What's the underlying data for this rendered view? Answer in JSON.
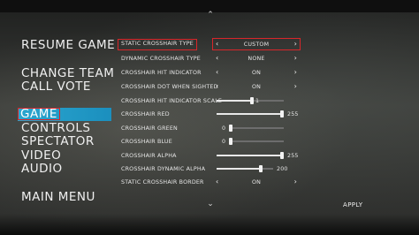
{
  "menu": {
    "items": [
      {
        "label": "RESUME GAME"
      },
      {
        "label": "CHANGE TEAM"
      },
      {
        "label": "CALL VOTE"
      },
      {
        "label": "GAME"
      },
      {
        "label": "CONTROLS"
      },
      {
        "label": "SPECTATOR"
      },
      {
        "label": "VIDEO"
      },
      {
        "label": "AUDIO"
      },
      {
        "label": "MAIN MENU"
      }
    ],
    "active_index": 3
  },
  "settings": {
    "rows": [
      {
        "name": "STATIC CROSSHAIR TYPE",
        "kind": "selector",
        "value": "CUSTOM"
      },
      {
        "name": "DYNAMIC CROSSHAIR TYPE",
        "kind": "selector",
        "value": "NONE"
      },
      {
        "name": "CROSSHAIR HIT INDICATOR",
        "kind": "selector",
        "value": "ON"
      },
      {
        "name": "CROSSHAIR DOT WHEN SIGHTED",
        "kind": "selector",
        "value": "ON"
      },
      {
        "name": "CROSSHAIR HIT INDICATOR SCALE",
        "kind": "slider",
        "value": "1",
        "fraction": 0.52
      },
      {
        "name": "CROSSHAIR RED",
        "kind": "slider",
        "value": "255",
        "fraction": 1.0
      },
      {
        "name": "CROSSHAIR GREEN",
        "kind": "slider",
        "value": "0",
        "fraction": 0.0
      },
      {
        "name": "CROSSHAIR BLUE",
        "kind": "slider",
        "value": "0",
        "fraction": 0.0
      },
      {
        "name": "CROSSHAIR ALPHA",
        "kind": "slider",
        "value": "255",
        "fraction": 1.0
      },
      {
        "name": "CROSSHAIR DYNAMIC ALPHA",
        "kind": "slider",
        "value": "200",
        "fraction": 0.78
      },
      {
        "name": "STATIC CROSSHAIR BORDER",
        "kind": "selector",
        "value": "ON"
      }
    ]
  },
  "apply_label": "APPLY",
  "icons": {
    "scroll_up": "chevron-up-icon",
    "scroll_down": "chevron-down-icon"
  },
  "colors": {
    "active_bg": "#2aa6cf",
    "highlight_border": "#d8262a"
  }
}
